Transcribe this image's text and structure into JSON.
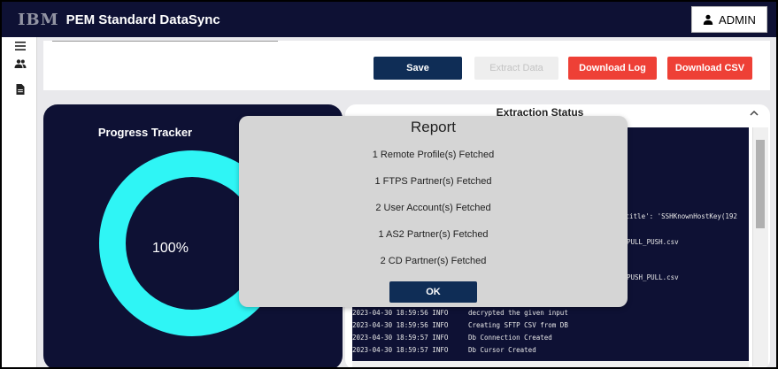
{
  "header": {
    "logo": "IBM",
    "title": "PEM Standard DataSync",
    "user_label": "ADMIN"
  },
  "sidebar": {
    "items": [
      {
        "icon": "menu-icon"
      },
      {
        "icon": "users-icon"
      },
      {
        "icon": "document-icon"
      }
    ]
  },
  "toolbar": {
    "save_label": "Save",
    "extract_label": "Extract Data",
    "download_log_label": "Download Log",
    "download_csv_label": "Download CSV"
  },
  "progress": {
    "title": "Progress Tracker",
    "value": 1.0,
    "text": "100%",
    "color": "#2ff5f5"
  },
  "status": {
    "title": "Extraction Status",
    "log_fragments": [
      "_title': 'SSHKnownHostKey(192",
      "PULL_PUSH.csv",
      "PUSH_PULL.csv"
    ],
    "log_lines": [
      "2023-04-30 18:59:56 INFO     decrypted the given input",
      "2023-04-30 18:59:56 INFO     Creating SFTP CSV from DB",
      "2023-04-30 18:59:57 INFO     Db Connection Created",
      "2023-04-30 18:59:57 INFO     Db Cursor Created"
    ]
  },
  "modal": {
    "title": "Report",
    "lines": [
      "1 Remote Profile(s) Fetched",
      "1 FTPS Partner(s) Fetched",
      "2 User Account(s) Fetched",
      "1 AS2 Partner(s) Fetched",
      "2 CD Partner(s) Fetched"
    ],
    "ok_label": "OK"
  },
  "colors": {
    "header_bg": "#0e1134",
    "primary_button": "#0f2d56",
    "danger_button": "#ee4036",
    "progress_ring": "#2ff5f5"
  }
}
